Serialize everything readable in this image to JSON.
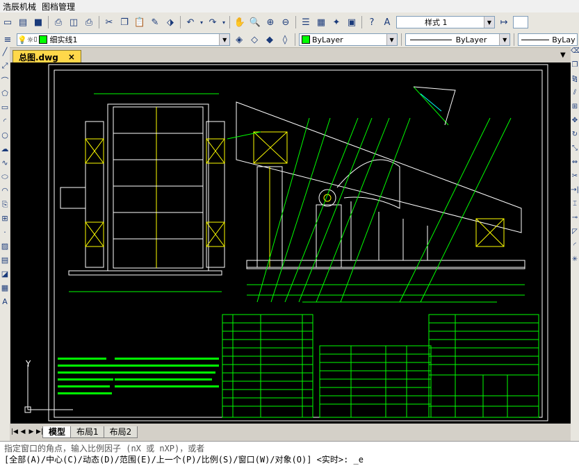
{
  "menu": [
    "浩辰机械",
    "图档管理"
  ],
  "toolbar": {
    "text_style": "样式 1",
    "layer_name": "细实线1",
    "color": "ByLayer",
    "linetype": "ByLayer",
    "lineweight": "ByLay"
  },
  "document_tab": {
    "title": "总图.dwg",
    "close": "×"
  },
  "layout_tabs": [
    "模型",
    "布局1",
    "布局2"
  ],
  "command_line": {
    "line1": "指定窗口的角点，输入比例因子 (nX 或 nXP)，或者",
    "line2": "[全部(A)/中心(C)/动态(D)/范围(E)/上一个(P)/比例(S)/窗口(W)/对象(O)] <实时>: _e"
  },
  "colors": {
    "accent_layer": "#00ff00",
    "tab": "#ffd84a",
    "canvas": "#000000",
    "drawing_green": "#00ff00",
    "drawing_white": "#ffffff",
    "drawing_yellow": "#ffff00",
    "drawing_cyan": "#00ffff"
  }
}
